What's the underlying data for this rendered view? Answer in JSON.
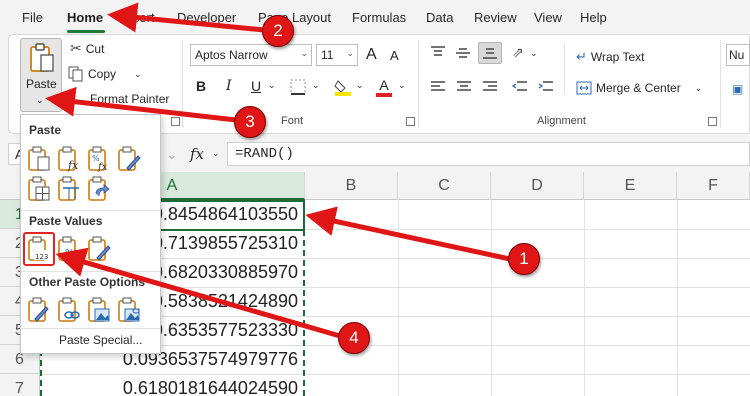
{
  "menu": {
    "tabs": [
      "File",
      "Home",
      "Insert",
      "Developer",
      "Page Layout",
      "Formulas",
      "Data",
      "Review",
      "View",
      "Help"
    ],
    "active_tab": "Home"
  },
  "ribbon": {
    "clipboard": {
      "paste_label": "Paste",
      "cut_label": "Cut",
      "copy_label": "Copy",
      "format_painter_label": "Format Painter"
    },
    "font": {
      "font_name": "Aptos Narrow",
      "font_size": "11",
      "group_label": "Font",
      "bold": "B",
      "italic": "I",
      "underline": "U",
      "grow": "A",
      "shrink": "A",
      "font_color_letter": "A"
    },
    "alignment": {
      "wrap_text_label": "Wrap Text",
      "merge_center_label": "Merge & Center",
      "group_label": "Alignment"
    },
    "number": {
      "format_partial": "Nu"
    }
  },
  "formula_bar": {
    "name_box": "A1",
    "fx_label": "fx",
    "formula": "=RAND()"
  },
  "grid": {
    "columns": [
      "A",
      "B",
      "C",
      "D",
      "E",
      "F"
    ],
    "rows": [
      "1",
      "2",
      "3",
      "4",
      "5",
      "6",
      "7"
    ],
    "selected_column": "A",
    "selected_row": "1",
    "column_a_values": [
      "0.8454864103550",
      "0.7139855725310",
      "0.6820330885970",
      "0.5838521424890",
      "0.6353577523330",
      "0.0936537574979776",
      "0.6180181644024590"
    ]
  },
  "paste_menu": {
    "paste_header": "Paste",
    "paste_values_header": "Paste Values",
    "other_options_header": "Other Paste Options",
    "paste_special_label": "Paste Special...",
    "paste_values_icon_text": "123"
  },
  "callouts": [
    "1",
    "2",
    "3",
    "4"
  ],
  "colors": {
    "accent_green": "#1d6b34",
    "callout_red": "#e01515",
    "clipboard_orange": "#d08a2a",
    "font_color_red": "#e02020",
    "highlight_yellow": "#ffe600"
  }
}
